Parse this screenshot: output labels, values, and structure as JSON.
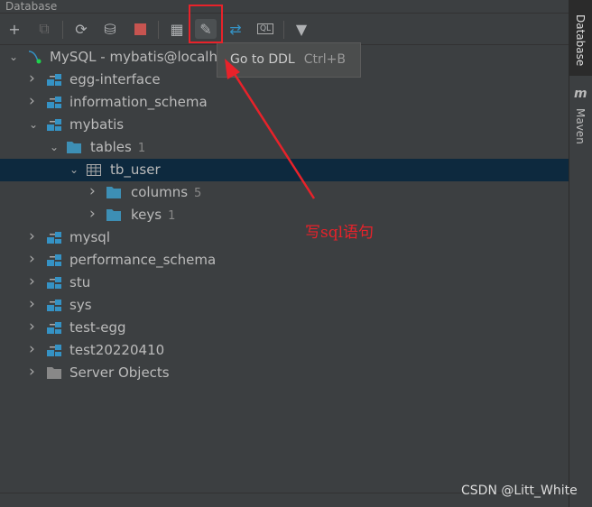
{
  "panel": {
    "title": "Database"
  },
  "toolbar": {
    "tooltip": "Go to DDL",
    "tooltip_shortcut": "Ctrl+B"
  },
  "tree": [
    {
      "label": "MySQL - mybatis@localho",
      "level": 0,
      "expanded": true,
      "icon": "mysql-icon"
    },
    {
      "label": "egg-interface",
      "level": 1,
      "expanded": false,
      "icon": "schema-icon"
    },
    {
      "label": "information_schema",
      "level": 1,
      "expanded": false,
      "icon": "schema-icon"
    },
    {
      "label": "mybatis",
      "level": 1,
      "expanded": true,
      "icon": "schema-icon"
    },
    {
      "label": "tables",
      "count": "1",
      "level": 2,
      "expanded": true,
      "icon": "folder-icon"
    },
    {
      "label": "tb_user",
      "level": 3,
      "expanded": true,
      "icon": "table-icon",
      "selected": true
    },
    {
      "label": "columns",
      "count": "5",
      "level": 4,
      "expanded": false,
      "icon": "folder-icon"
    },
    {
      "label": "keys",
      "count": "1",
      "level": 4,
      "expanded": false,
      "icon": "folder-icon"
    },
    {
      "label": "mysql",
      "level": 1,
      "expanded": false,
      "icon": "schema-icon"
    },
    {
      "label": "performance_schema",
      "level": 1,
      "expanded": false,
      "icon": "schema-icon"
    },
    {
      "label": "stu",
      "level": 1,
      "expanded": false,
      "icon": "schema-icon"
    },
    {
      "label": "sys",
      "level": 1,
      "expanded": false,
      "icon": "schema-icon"
    },
    {
      "label": "test-egg",
      "level": 1,
      "expanded": false,
      "icon": "schema-icon"
    },
    {
      "label": "test20220410",
      "level": 1,
      "expanded": false,
      "icon": "schema-icon"
    },
    {
      "label": "Server Objects",
      "level": 1,
      "expanded": false,
      "icon": "server-folder-icon"
    }
  ],
  "side_tabs": {
    "database": "Database",
    "maven": "Maven"
  },
  "annotation": "写sql语句",
  "watermark": "CSDN @Litt_White",
  "colors": {
    "accent": "#3592c4",
    "annotation": "#e8222a",
    "selection": "#0d293e"
  }
}
